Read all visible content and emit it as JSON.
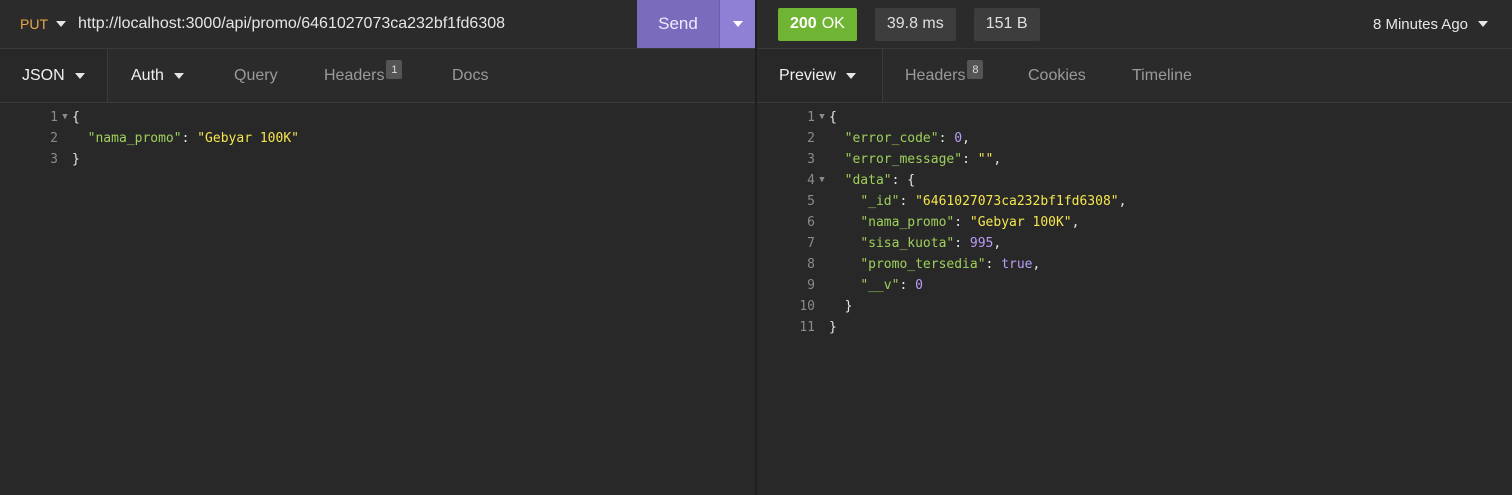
{
  "request": {
    "method": "PUT",
    "url": "http://localhost:3000/api/promo/6461027073ca232bf1fd6308",
    "send_label": "Send",
    "tabs": [
      {
        "label": "JSON"
      },
      {
        "label": "Auth"
      },
      {
        "label": "Query"
      },
      {
        "label": "Headers",
        "badge": "1"
      },
      {
        "label": "Docs"
      }
    ],
    "body_lines": [
      {
        "n": "1",
        "text": "{"
      },
      {
        "n": "2",
        "key": "\"nama_promo\"",
        "value": "\"Gebyar 100K\""
      },
      {
        "n": "3",
        "text": "}"
      }
    ]
  },
  "response": {
    "status_code": "200",
    "status_text": "OK",
    "time": "39.8 ms",
    "size": "151 B",
    "time_ago": "8 Minutes Ago",
    "tabs": [
      {
        "label": "Preview"
      },
      {
        "label": "Headers",
        "badge": "8"
      },
      {
        "label": "Cookies"
      },
      {
        "label": "Timeline"
      }
    ],
    "lines": [
      {
        "n": "1",
        "open": "{"
      },
      {
        "n": "2",
        "key": "\"error_code\"",
        "value": "0",
        "comma": ","
      },
      {
        "n": "3",
        "key": "\"error_message\"",
        "value": "\"\"",
        "comma": ","
      },
      {
        "n": "4",
        "key": "\"data\"",
        "open": "{"
      },
      {
        "n": "5",
        "key": "\"_id\"",
        "value": "\"6461027073ca232bf1fd6308\"",
        "comma": ","
      },
      {
        "n": "6",
        "key": "\"nama_promo\"",
        "value": "\"Gebyar 100K\"",
        "comma": ","
      },
      {
        "n": "7",
        "key": "\"sisa_kuota\"",
        "value": "995",
        "comma": ","
      },
      {
        "n": "8",
        "key": "\"promo_tersedia\"",
        "value": "true",
        "comma": ","
      },
      {
        "n": "9",
        "key": "\"__v\"",
        "value": "0"
      },
      {
        "n": "10",
        "close": "}"
      },
      {
        "n": "11",
        "close": "}"
      }
    ]
  },
  "colors": {
    "method": "#e8a54b",
    "send": "#7b6bbd",
    "status_ok": "#6fb432",
    "json_key": "#9ed05a",
    "json_string": "#f5e64e",
    "json_number": "#b89cf7"
  },
  "icons": [
    "caret-down-icon",
    "fold-arrow-icon"
  ]
}
